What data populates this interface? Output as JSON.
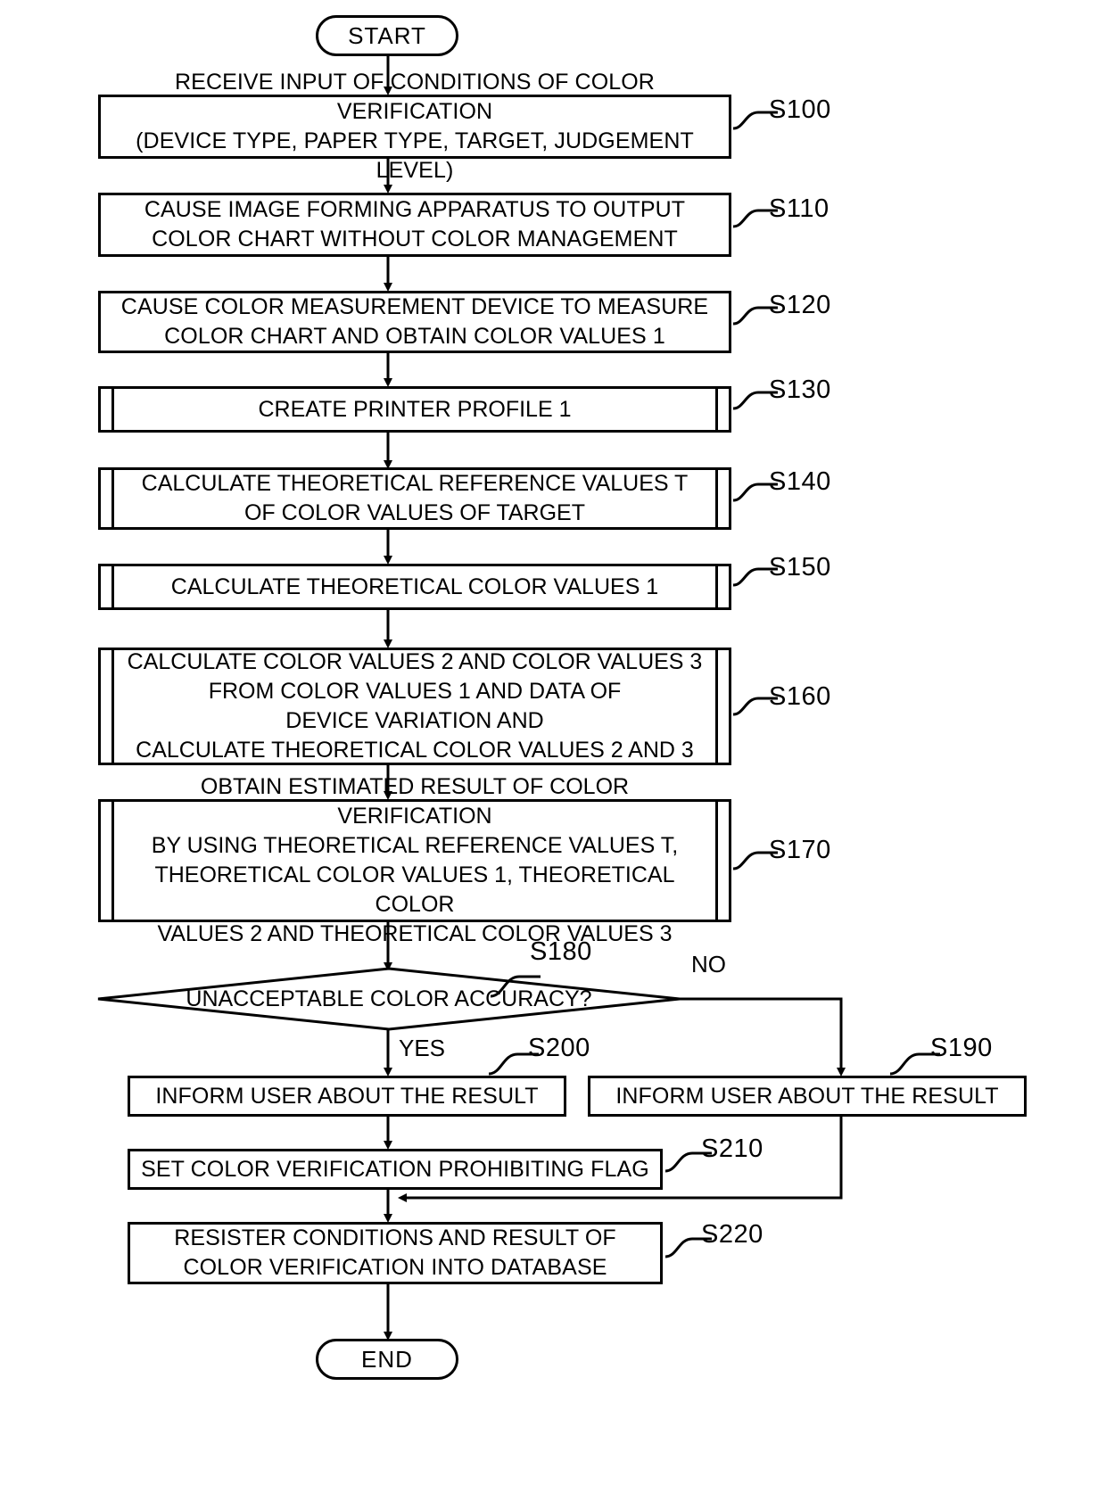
{
  "figure": {
    "type": "flowchart",
    "orientation": "vertical",
    "background_color": "#ffffff",
    "line_color": "#000000"
  },
  "terminals": {
    "start": "START",
    "end": "END"
  },
  "steps": [
    {
      "ref": "S100",
      "shape": "process",
      "text": "RECEIVE INPUT OF CONDITIONS OF COLOR VERIFICATION\n(DEVICE TYPE, PAPER TYPE, TARGET, JUDGEMENT LEVEL)"
    },
    {
      "ref": "S110",
      "shape": "process",
      "text": "CAUSE IMAGE FORMING APPARATUS TO OUTPUT\nCOLOR CHART WITHOUT COLOR MANAGEMENT"
    },
    {
      "ref": "S120",
      "shape": "process",
      "text": "CAUSE COLOR MEASUREMENT DEVICE TO MEASURE\nCOLOR CHART AND OBTAIN COLOR VALUES 1"
    },
    {
      "ref": "S130",
      "shape": "predefined-process",
      "text": "CREATE PRINTER PROFILE 1"
    },
    {
      "ref": "S140",
      "shape": "predefined-process",
      "text": "CALCULATE THEORETICAL REFERENCE VALUES T\nOF COLOR VALUES OF TARGET"
    },
    {
      "ref": "S150",
      "shape": "predefined-process",
      "text": "CALCULATE THEORETICAL COLOR VALUES 1"
    },
    {
      "ref": "S160",
      "shape": "predefined-process",
      "text": "CALCULATE COLOR VALUES 2 AND COLOR VALUES 3\nFROM COLOR VALUES 1 AND DATA OF\nDEVICE VARIATION AND\nCALCULATE THEORETICAL COLOR VALUES 2 AND 3"
    },
    {
      "ref": "S170",
      "shape": "predefined-process",
      "text": "OBTAIN ESTIMATED RESULT OF COLOR VERIFICATION\nBY USING THEORETICAL REFERENCE VALUES T,\nTHEORETICAL COLOR VALUES 1, THEORETICAL COLOR\nVALUES 2 AND THEORETICAL COLOR VALUES 3"
    },
    {
      "ref": "S180",
      "shape": "decision",
      "text": "UNACCEPTABLE COLOR ACCURACY?"
    },
    {
      "ref": "S200",
      "shape": "process",
      "text": "INFORM USER ABOUT THE RESULT"
    },
    {
      "ref": "S190",
      "shape": "process",
      "text": "INFORM USER ABOUT THE RESULT"
    },
    {
      "ref": "S210",
      "shape": "process",
      "text": "SET COLOR VERIFICATION PROHIBITING FLAG"
    },
    {
      "ref": "S220",
      "shape": "process",
      "text": "RESISTER CONDITIONS AND RESULT OF\nCOLOR VERIFICATION INTO DATABASE"
    }
  ],
  "edge_labels": {
    "yes": "YES",
    "no": "NO"
  }
}
